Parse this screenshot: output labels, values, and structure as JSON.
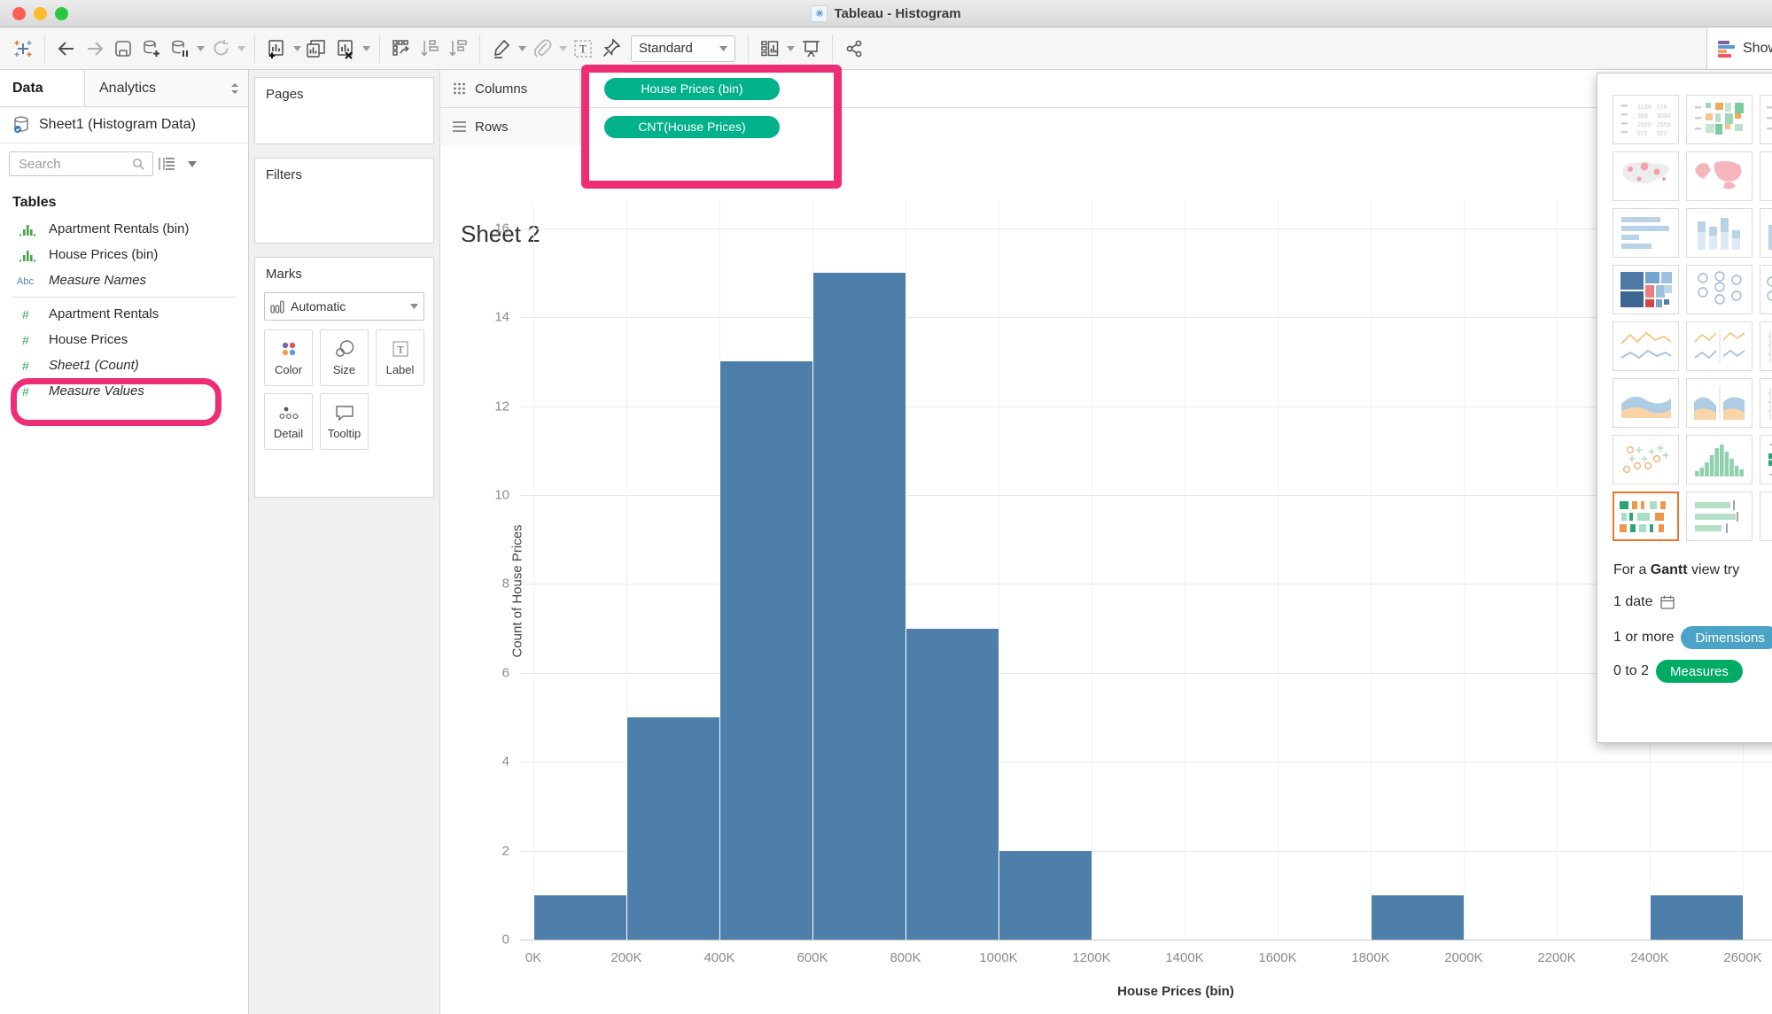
{
  "window": {
    "title": "Tableau - Histogram"
  },
  "toolbar": {
    "standard_label": "Standard",
    "show_me_label": "Show Me",
    "icons": [
      "tableau-logo",
      "back-arrow",
      "forward-arrow",
      "save",
      "add-data",
      "pause-auto-updates",
      "refresh",
      "new-worksheet",
      "duplicate-sheet",
      "clear-sheet",
      "swap-rows-columns",
      "sort-ascending",
      "sort-descending",
      "highlight",
      "format-annotation",
      "show-mark-labels",
      "fix-axes",
      "fit-select",
      "show-cards",
      "presentation-mode",
      "share"
    ]
  },
  "datapane": {
    "tabs": {
      "data": "Data",
      "analytics": "Analytics"
    },
    "connection": "Sheet1 (Histogram Data)",
    "search_placeholder": "Search",
    "tables_header": "Tables",
    "fields": [
      {
        "label": "Apartment Rentals (bin)",
        "icon": "histogram-bin",
        "italic": false
      },
      {
        "label": "House Prices (bin)",
        "icon": "histogram-bin",
        "italic": false,
        "highlighted": true
      },
      {
        "label": "Measure Names",
        "icon": "abc",
        "italic": true
      },
      {
        "label": "Apartment Rentals",
        "icon": "number",
        "italic": false
      },
      {
        "label": "House Prices",
        "icon": "number",
        "italic": false
      },
      {
        "label": "Sheet1 (Count)",
        "icon": "number",
        "italic": true
      },
      {
        "label": "Measure Values",
        "icon": "number",
        "italic": true
      }
    ]
  },
  "shelves": {
    "pages_label": "Pages",
    "filters_label": "Filters",
    "marks_label": "Marks",
    "mark_type": "Automatic",
    "mark_buttons": [
      "Color",
      "Size",
      "Label",
      "Detail",
      "Tooltip"
    ],
    "columns_label": "Columns",
    "rows_label": "Rows",
    "columns_pill": "House Prices (bin)",
    "rows_pill": "CNT(House Prices)"
  },
  "sheet": {
    "title": "Sheet 2"
  },
  "chart_data": {
    "type": "bar",
    "subtype": "histogram",
    "title": "Sheet 2",
    "xlabel": "House Prices (bin)",
    "ylabel": "Count of House Prices",
    "bin_width_label": "200K",
    "x_ticks": [
      "0K",
      "200K",
      "400K",
      "600K",
      "800K",
      "1000K",
      "1200K",
      "1400K",
      "1600K",
      "1800K",
      "2000K",
      "2200K",
      "2400K",
      "2600K"
    ],
    "bin_starts": [
      "0K",
      "200K",
      "400K",
      "600K",
      "800K",
      "1000K",
      "1200K",
      "1400K",
      "1600K",
      "1800K",
      "2000K",
      "2200K",
      "2400K"
    ],
    "counts": [
      1,
      5,
      13,
      15,
      7,
      2,
      0,
      0,
      0,
      1,
      0,
      0,
      1
    ],
    "y_ticks": [
      0,
      2,
      4,
      6,
      8,
      10,
      12,
      14,
      16
    ],
    "ylim": [
      0,
      16
    ],
    "grid": true,
    "legend": "none",
    "bar_color": "#4e7fab"
  },
  "showme": {
    "items": [
      "text-table",
      "highlight-table",
      "heatmap",
      "symbol-map",
      "filled-map",
      "pie",
      "horizontal-bars",
      "stacked-bars",
      "side-by-side-bars",
      "treemap",
      "circle-views",
      "side-by-side-circles",
      "line-continuous",
      "line-discrete",
      "dual-line",
      "area-continuous",
      "area-discrete",
      "dual-combination",
      "scatter",
      "histogram",
      "box-plot",
      "gantt",
      "bullet",
      "packed-bubbles"
    ],
    "selected": "gantt",
    "text_table_sample": [
      [
        "1234",
        "678"
      ],
      [
        "368",
        "3034"
      ],
      [
        "2620",
        "2559"
      ],
      [
        "971",
        "322"
      ]
    ],
    "hint": {
      "prefix": "For a ",
      "bold": "Gantt",
      "suffix": " view try",
      "req1_text": "1 date",
      "req2_text": "1 or more",
      "req2_pill": "Dimensions",
      "req3_text": "0 to 2",
      "req3_pill": "Measures"
    }
  },
  "colors": {
    "accent_pill_green": "#00b18a",
    "bar_blue": "#4e7fab",
    "annotation_pink": "#ee2d74",
    "dimensions_pill_blue": "#4ba3c7",
    "measures_pill_green": "#00ab66",
    "selected_thumb_orange": "#e8762c",
    "field_icon_green": "#47a447",
    "abc_icon_blue": "#4f81bd"
  }
}
